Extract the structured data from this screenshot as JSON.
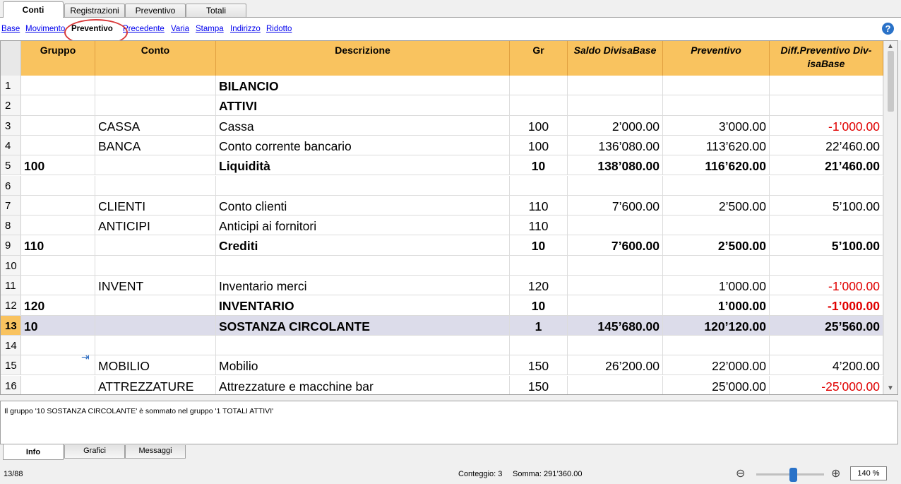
{
  "top_tabs": [
    "Conti",
    "Registrazioni",
    "Preventivo",
    "Totali"
  ],
  "views": [
    "Base",
    "Movimento",
    "Preventivo",
    "Precedente",
    "Varia",
    "Stampa",
    "Indirizzo",
    "Ridotto"
  ],
  "help_label": "?",
  "headers": {
    "gruppo": "Gruppo",
    "conto": "Conto",
    "descrizione": "Descrizione",
    "gr": "Gr",
    "saldo": "Saldo DivisaBase",
    "preventivo": "Preventivo",
    "diff": "Diff.Preventivo Div-isaBase"
  },
  "rows": [
    {
      "n": "1",
      "gruppo": "",
      "conto": "",
      "desc": "BILANCIO",
      "gr": "",
      "saldo": "",
      "prev": "",
      "diff": ""
    },
    {
      "n": "2",
      "gruppo": "",
      "conto": "",
      "desc": "ATTIVI",
      "gr": "",
      "saldo": "",
      "prev": "",
      "diff": ""
    },
    {
      "n": "3",
      "gruppo": "",
      "conto": "CASSA",
      "desc": "Cassa",
      "gr": "100",
      "saldo": "2’000.00",
      "prev": "3’000.00",
      "diff": "-1’000.00"
    },
    {
      "n": "4",
      "gruppo": "",
      "conto": "BANCA",
      "desc": "Conto corrente bancario",
      "gr": "100",
      "saldo": "136’080.00",
      "prev": "113’620.00",
      "diff": "22’460.00"
    },
    {
      "n": "5",
      "gruppo": "100",
      "conto": "",
      "desc": "Liquidità",
      "gr": "10",
      "saldo": "138’080.00",
      "prev": "116’620.00",
      "diff": "21’460.00"
    },
    {
      "n": "6",
      "gruppo": "",
      "conto": "",
      "desc": "",
      "gr": "",
      "saldo": "",
      "prev": "",
      "diff": ""
    },
    {
      "n": "7",
      "gruppo": "",
      "conto": "CLIENTI",
      "desc": "Conto clienti",
      "gr": "110",
      "saldo": "7’600.00",
      "prev": "2’500.00",
      "diff": "5’100.00"
    },
    {
      "n": "8",
      "gruppo": "",
      "conto": "ANTICIPI",
      "desc": "Anticipi ai fornitori",
      "gr": "110",
      "saldo": "",
      "prev": "",
      "diff": ""
    },
    {
      "n": "9",
      "gruppo": "110",
      "conto": "",
      "desc": "Crediti",
      "gr": "10",
      "saldo": "7’600.00",
      "prev": "2’500.00",
      "diff": "5’100.00"
    },
    {
      "n": "10",
      "gruppo": "",
      "conto": "",
      "desc": "",
      "gr": "",
      "saldo": "",
      "prev": "",
      "diff": ""
    },
    {
      "n": "11",
      "gruppo": "",
      "conto": "INVENT",
      "desc": "Inventario merci",
      "gr": "120",
      "saldo": "",
      "prev": "1’000.00",
      "diff": "-1’000.00"
    },
    {
      "n": "12",
      "gruppo": "120",
      "conto": "",
      "desc": "INVENTARIO",
      "gr": "10",
      "saldo": "",
      "prev": "1’000.00",
      "diff": "-1’000.00"
    },
    {
      "n": "13",
      "gruppo": "10",
      "conto": "",
      "desc": "SOSTANZA CIRCOLANTE",
      "gr": "1",
      "saldo": "145’680.00",
      "prev": "120’120.00",
      "diff": "25’560.00"
    },
    {
      "n": "14",
      "gruppo": "",
      "conto": "",
      "desc": "",
      "gr": "",
      "saldo": "",
      "prev": "",
      "diff": ""
    },
    {
      "n": "15",
      "gruppo": "",
      "conto": "MOBILIO",
      "desc": "Mobilio",
      "gr": "150",
      "saldo": "26’200.00",
      "prev": "22’000.00",
      "diff": "4’200.00"
    },
    {
      "n": "16",
      "gruppo": "",
      "conto": "ATTREZZATURE",
      "desc": "Attrezzature e macchine bar",
      "gr": "150",
      "saldo": "",
      "prev": "25’000.00",
      "diff": "-25’000.00"
    }
  ],
  "info_text": "Il gruppo '10 SOSTANZA CIRCOLANTE' è sommato nel gruppo '1 TOTALI ATTIVI'",
  "bottom_tabs": [
    "Info",
    "Grafici",
    "Messaggi"
  ],
  "status": {
    "position": "13/88",
    "conteggio": "Conteggio: 3",
    "somma": "Somma: 291’360.00",
    "zoom": "140 %"
  },
  "colors": {
    "header_bg": "#f9c35f",
    "selected_row_bg": "#dcdcea",
    "negative": "#e00000",
    "link": "#0000ee",
    "highlight_ellipse": "#d93a3a"
  }
}
